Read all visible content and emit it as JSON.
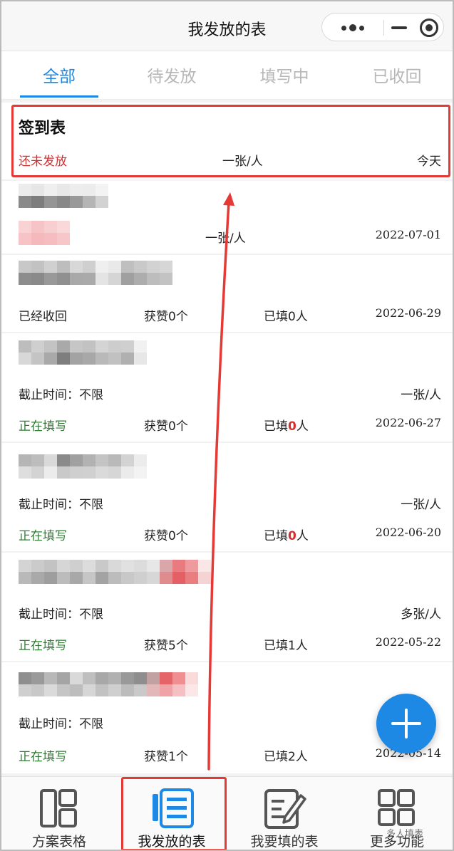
{
  "header": {
    "title": "我发放的表"
  },
  "tabs": [
    {
      "label": "全部"
    },
    {
      "label": "待发放"
    },
    {
      "label": "填写中"
    },
    {
      "label": "已收回"
    }
  ],
  "cards": [
    {
      "title": "签到表",
      "status": "还未发放",
      "count": "一张/人",
      "date": "今天"
    },
    {
      "count": "一张/人",
      "date": "2022-07-01"
    },
    {
      "status": "已经收回",
      "likes": "获赞0个",
      "filled": "已填0人",
      "date": "2022-06-29"
    },
    {
      "deadline": "截止时间：不限",
      "count": "一张/人",
      "status": "正在填写",
      "likes": "获赞0个",
      "filled_prefix": "已填",
      "filled_num": "0",
      "filled_suffix": "人",
      "date": "2022-06-27"
    },
    {
      "deadline": "截止时间：不限",
      "count": "一张/人",
      "status": "正在填写",
      "likes": "获赞0个",
      "filled_prefix": "已填",
      "filled_num": "0",
      "filled_suffix": "人",
      "date": "2022-06-20"
    },
    {
      "deadline": "截止时间：不限",
      "count": "多张/人",
      "status": "正在填写",
      "likes": "获赞5个",
      "filled": "已填1人",
      "date": "2022-05-22"
    },
    {
      "deadline": "截止时间：不限",
      "status": "正在填写",
      "likes": "获赞1个",
      "filled": "已填2人",
      "date": "2022-05-14"
    }
  ],
  "bottom_nav": [
    {
      "label": "方案表格",
      "icon": "layout-icon"
    },
    {
      "label": "我发放的表",
      "icon": "document-list-icon"
    },
    {
      "label": "我要填的表",
      "icon": "edit-form-icon"
    },
    {
      "label": "更多功能",
      "icon": "grid-icon"
    }
  ],
  "watermark": "多人填表",
  "colors": {
    "accent": "#1e88e5",
    "status_red": "#d32f2f",
    "status_green": "#2e7d32",
    "annotation_red": "#e53935"
  }
}
